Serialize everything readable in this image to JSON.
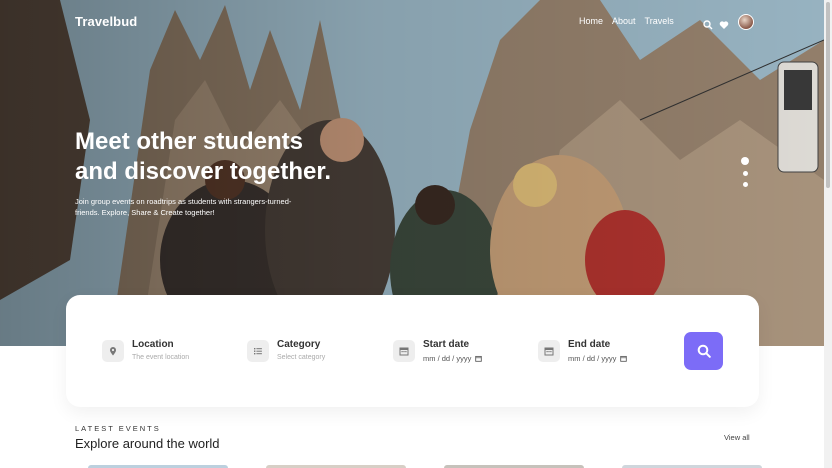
{
  "brand": {
    "name": "Travelbud"
  },
  "nav": {
    "links": [
      "Home",
      "About",
      "Travels"
    ]
  },
  "hero": {
    "headline_line1": "Meet other students",
    "headline_line2": "and discover together.",
    "subtext": "Join group events on roadtrips as students with strangers-turned-friends. Explore, Share & Create together!",
    "slides": 3,
    "active_slide": 1
  },
  "search": {
    "location": {
      "label": "Location",
      "placeholder": "The event location"
    },
    "category": {
      "label": "Category",
      "placeholder": "Select category"
    },
    "start_date": {
      "label": "Start date",
      "value": "mm / dd / yyyy"
    },
    "end_date": {
      "label": "End date",
      "value": "mm / dd / yyyy"
    }
  },
  "events": {
    "eyebrow": "LATEST EVENTS",
    "title": "Explore around the world",
    "view_all": "View all"
  },
  "colors": {
    "accent": "#7c6cf7",
    "hero_text": "#ffffff"
  },
  "icons": [
    "search-icon",
    "heart-icon",
    "location-pin-icon",
    "list-icon",
    "calendar-icon"
  ]
}
